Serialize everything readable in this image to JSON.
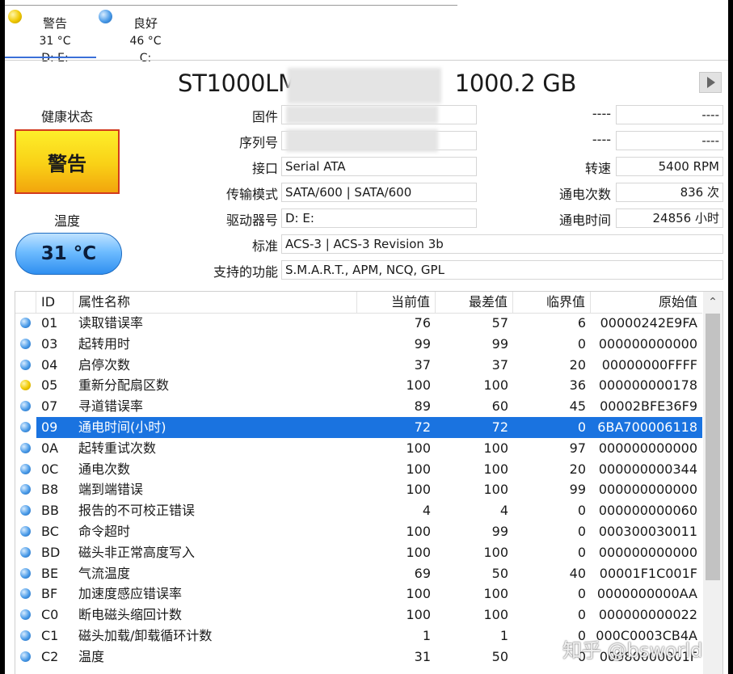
{
  "drives": [
    {
      "status": "警告",
      "temperature": "31 °C",
      "letters": "D: E:",
      "status_color": "#f0c800"
    },
    {
      "status": "良好",
      "temperature": "46 °C",
      "letters": "C:",
      "status_color": "#4a9be8"
    }
  ],
  "model": {
    "name_left": "ST1000LM",
    "capacity": "1000.2 GB"
  },
  "health": {
    "label": "健康状态",
    "value": "警告",
    "color": "#f9d016"
  },
  "temperature": {
    "label": "温度",
    "value": "31 °C"
  },
  "info": {
    "firmware_label": "固件",
    "firmware_value": "",
    "serial_label": "序列号",
    "serial_value": "",
    "interface_label": "接口",
    "interface_value": "Serial ATA",
    "transfer_label": "传输模式",
    "transfer_value": "SATA/600 | SATA/600",
    "drive_letter_label": "驱动器号",
    "drive_letter_value": "D: E:",
    "standard_label": "标准",
    "standard_value": "ACS-3 | ACS-3 Revision 3b",
    "features_label": "支持的功能",
    "features_value": "S.M.A.R.T., APM, NCQ, GPL",
    "right1_label": "----",
    "right1_value": "----",
    "right2_label": "----",
    "right2_value": "----",
    "rpm_label": "转速",
    "rpm_value": "5400 RPM",
    "power_count_label": "通电次数",
    "power_count_value": "836 次",
    "power_hours_label": "通电时间",
    "power_hours_value": "24856 小时"
  },
  "table": {
    "headers": {
      "id": "ID",
      "name": "属性名称",
      "current": "当前值",
      "worst": "最差值",
      "threshold": "临界值",
      "raw": "原始值"
    },
    "rows": [
      {
        "status": "good",
        "id": "01",
        "name": "读取错误率",
        "current": "76",
        "worst": "57",
        "threshold": "6",
        "raw": "00000242E9FA"
      },
      {
        "status": "good",
        "id": "03",
        "name": "起转用时",
        "current": "99",
        "worst": "99",
        "threshold": "0",
        "raw": "000000000000"
      },
      {
        "status": "good",
        "id": "04",
        "name": "启停次数",
        "current": "37",
        "worst": "37",
        "threshold": "20",
        "raw": "00000000FFFF"
      },
      {
        "status": "warn",
        "id": "05",
        "name": "重新分配扇区数",
        "current": "100",
        "worst": "100",
        "threshold": "36",
        "raw": "000000000178"
      },
      {
        "status": "good",
        "id": "07",
        "name": "寻道错误率",
        "current": "89",
        "worst": "60",
        "threshold": "45",
        "raw": "00002BFE36F9"
      },
      {
        "status": "good",
        "id": "09",
        "name": "通电时间(小时)",
        "current": "72",
        "worst": "72",
        "threshold": "0",
        "raw": "6BA700006118",
        "selected": true
      },
      {
        "status": "good",
        "id": "0A",
        "name": "起转重试次数",
        "current": "100",
        "worst": "100",
        "threshold": "97",
        "raw": "000000000000"
      },
      {
        "status": "good",
        "id": "0C",
        "name": "通电次数",
        "current": "100",
        "worst": "100",
        "threshold": "20",
        "raw": "000000000344"
      },
      {
        "status": "good",
        "id": "B8",
        "name": "端到端错误",
        "current": "100",
        "worst": "100",
        "threshold": "99",
        "raw": "000000000000"
      },
      {
        "status": "good",
        "id": "BB",
        "name": "报告的不可校正错误",
        "current": "4",
        "worst": "4",
        "threshold": "0",
        "raw": "000000000060"
      },
      {
        "status": "good",
        "id": "BC",
        "name": "命令超时",
        "current": "100",
        "worst": "99",
        "threshold": "0",
        "raw": "000300030011"
      },
      {
        "status": "good",
        "id": "BD",
        "name": "磁头非正常高度写入",
        "current": "100",
        "worst": "100",
        "threshold": "0",
        "raw": "000000000000"
      },
      {
        "status": "good",
        "id": "BE",
        "name": "气流温度",
        "current": "69",
        "worst": "50",
        "threshold": "40",
        "raw": "00001F1C001F"
      },
      {
        "status": "good",
        "id": "BF",
        "name": "加速度感应错误率",
        "current": "100",
        "worst": "100",
        "threshold": "0",
        "raw": "0000000000AA"
      },
      {
        "status": "good",
        "id": "C0",
        "name": "断电磁头缩回计数",
        "current": "100",
        "worst": "100",
        "threshold": "0",
        "raw": "000000000022"
      },
      {
        "status": "good",
        "id": "C1",
        "name": "磁头加载/卸载循环计数",
        "current": "1",
        "worst": "1",
        "threshold": "0",
        "raw": "000C0003CB4A"
      },
      {
        "status": "good",
        "id": "C2",
        "name": "温度",
        "current": "31",
        "worst": "50",
        "threshold": "0",
        "raw": "00080000001F"
      }
    ]
  },
  "watermark": "知乎 @bsworld",
  "colors": {
    "good": "#4a9be8",
    "warn": "#f0c800",
    "selected": "#1a73e0"
  }
}
